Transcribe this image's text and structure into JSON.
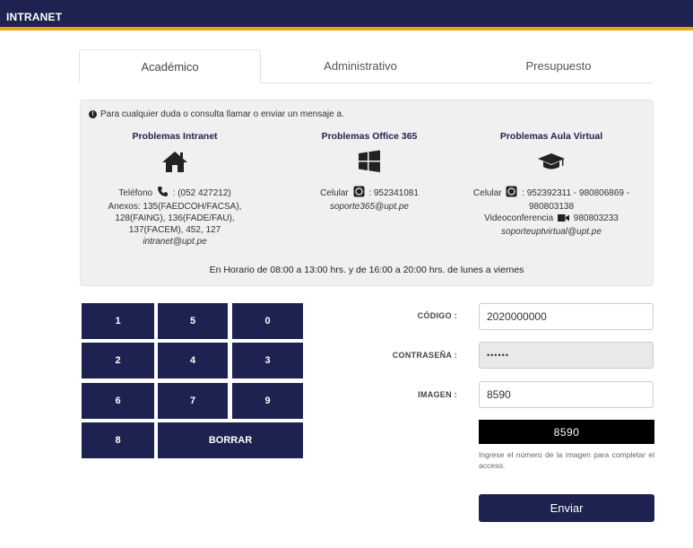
{
  "header": {
    "brand": "INTRANET"
  },
  "tabs": [
    {
      "label": "Académico"
    },
    {
      "label": "Administrativo"
    },
    {
      "label": "Presupuesto"
    }
  ],
  "info": {
    "notice": "Para cualquier duda o consulta llamar o enviar un mensaje a.",
    "intranet": {
      "title": "Problemas Intranet",
      "phone_label": "Teléfono",
      "phone": ": (052 427212)",
      "annex_1": "Anexos: 135(FAEDCOH/FACSA),",
      "annex_2": "128(FAING), 136(FADE/FAU),",
      "annex_3": "137(FACEM), 452, 127",
      "email": "intranet@upt.pe"
    },
    "office": {
      "title": "Problemas Office 365",
      "cell_label": "Celular",
      "cell": ": 952341081",
      "email": "soporte365@upt.pe"
    },
    "virtual": {
      "title": "Problemas Aula Virtual",
      "cell_label": "Celular",
      "cell_1": ": 952392311 - 980806869 -",
      "cell_2": "980803138",
      "video_label": "Videoconferencia",
      "video": " 980803233",
      "email": "soporteuptvirtual@upt.pe"
    },
    "schedule": "En Horario de 08:00 a 13:00 hrs. y de 16:00 a 20:00 hrs. de lunes a viernes"
  },
  "keypad": {
    "keys": [
      "1",
      "5",
      "0",
      "2",
      "4",
      "3",
      "6",
      "7",
      "9",
      "8"
    ],
    "clear": "BORRAR"
  },
  "form": {
    "code_label": "CÓDIGO :",
    "code_value": "2020000000",
    "password_label": "CONTRASEÑA :",
    "password_value": "••••••",
    "image_label": "IMAGEN :",
    "image_value": "8590",
    "captcha": "8590",
    "help": "Ingrese el número de la imagen para completar el acceso.",
    "submit": "Enviar"
  },
  "colors": {
    "navy": "#1d2250",
    "accent": "#f0a020"
  }
}
